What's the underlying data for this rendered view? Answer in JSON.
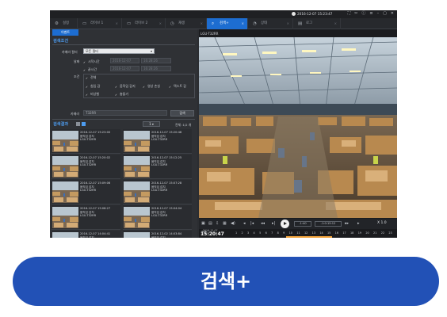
{
  "titlebar": {
    "datetime": "2016-12-07 15:23:47",
    "icons": [
      "fullscreen-icon",
      "tools-icon",
      "info-icon",
      "menu-icon",
      "minimize-icon",
      "restore-icon",
      "close-icon"
    ]
  },
  "tabs": [
    {
      "label": "설정",
      "icon": "gear-icon",
      "active": false
    },
    {
      "label": "라이브 1",
      "icon": "monitor-icon",
      "active": false
    },
    {
      "label": "라이브 2",
      "icon": "monitor-icon",
      "active": false
    },
    {
      "label": "재생",
      "icon": "playback-icon",
      "active": false
    },
    {
      "label": "검색+",
      "icon": "search-icon",
      "active": true
    },
    {
      "label": "상태",
      "icon": "status-icon",
      "active": false
    },
    {
      "label": "로그",
      "icon": "log-icon",
      "active": false
    }
  ],
  "left": {
    "subtab": "이벤트",
    "search_condition_title": "검색조건",
    "camera_group_label": "카메라 필터",
    "camera_group_value": "모든 필터",
    "date_label": "날짜",
    "start_time_label": "시작시간",
    "start_date": "2016-12-07",
    "start_time": "16:28:26",
    "end_time_label": "끝시간",
    "end_date": "2016-12-07",
    "end_time": "16:28:26",
    "conditions_label": "조건",
    "conditions": [
      "전체",
      "침입 감",
      "움직임 감지",
      "영상 손실",
      "텍스트 감",
      "비상벨",
      "충돌기"
    ],
    "camera_name_label": "카메라",
    "camera_name_value": "T32RR",
    "search_button": "검색",
    "results_title": "검색결과",
    "page_value": "1",
    "total_label": "전체 :1/2 개",
    "results": [
      {
        "time": "2016-12-07 15:23:00",
        "event": "움직임 감지",
        "camera": "LGU-T32RR"
      },
      {
        "time": "2016-12-07 15:20:48",
        "event": "움직임 감지",
        "camera": "LGU-T32RR"
      },
      {
        "time": "2016-12-07 15:20:02",
        "event": "움직임 감지",
        "camera": "LGU-T32RR"
      },
      {
        "time": "2016-12-07 15:12:25",
        "event": "움직임 감지",
        "camera": "LGU-T32RR"
      },
      {
        "time": "2016-12-07 15:09:06",
        "event": "움직임 감지",
        "camera": "LGU-T32RR"
      },
      {
        "time": "2016-12-07 15:07:28",
        "event": "움직임 감지",
        "camera": "LGU-T32RR"
      },
      {
        "time": "2016-12-07 15:08:27",
        "event": "움직임 감지",
        "camera": "LGU-T32RR"
      },
      {
        "time": "2016-12-07 15:04:04",
        "event": "움직임 감지",
        "camera": "LGU-T32RR"
      },
      {
        "time": "2016-12-07 14:04:41",
        "event": "움직임 감지",
        "camera": "LGU-T32RR"
      },
      {
        "time": "2016-12-02 14:03:84",
        "event": "움직임 감지",
        "camera": "LGU-T32RR"
      }
    ]
  },
  "right": {
    "camera_label": "LGU-T32RR",
    "speed_minus": "-1:40",
    "speed_value": "-1:0:15:12",
    "speed_label": "X 1.0",
    "timeline_date": "2016-12-07",
    "timeline_time": "15:20:47",
    "timeline_hours": [
      "1",
      "2",
      "3",
      "4",
      "5",
      "6",
      "7",
      "8",
      "9",
      "10",
      "11",
      "12",
      "13",
      "14",
      "15",
      "16",
      "17",
      "18",
      "19",
      "20",
      "21",
      "22",
      "23"
    ],
    "all_label": "전체"
  },
  "main_button": "검색+"
}
